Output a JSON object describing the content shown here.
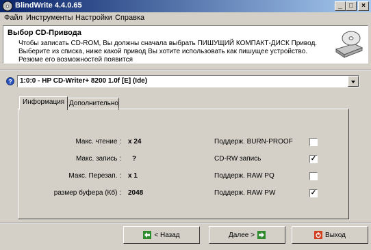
{
  "window": {
    "title": "BlindWrite 4.4.0.65"
  },
  "menu": [
    "Файл",
    "Инструменты",
    "Настройки",
    "Справка"
  ],
  "header": {
    "title": "Выбор CD-Привода",
    "lines": [
      "Чтобы записать CD-ROM, Вы должны сначала выбрать ПИШУЩИЙ КОМПАКТ-ДИСК Привод.",
      "Выберите из списка, ниже какой привод Вы хотите использовать как пишущее устройство.",
      "Резюме его возможностей появится"
    ]
  },
  "drive": {
    "selected": "1:0:0 - HP CD-Writer+ 8200 1.0f [E] (Ide)"
  },
  "tabs": [
    "Информация",
    "Дополнительно"
  ],
  "info": {
    "left": [
      {
        "label": "Макс. чтение :",
        "value": "x 24"
      },
      {
        "label": "Макс. запись :",
        "value": "?"
      },
      {
        "label": "Макс. Перезап. :",
        "value": "x 1"
      },
      {
        "label": "размер буфера (Кб) :",
        "value": "2048"
      }
    ],
    "right": [
      {
        "label": "Поддерж. BURN-PROOF",
        "checked": false
      },
      {
        "label": "CD-RW запись",
        "checked": true
      },
      {
        "label": "Поддерж. RAW PQ",
        "checked": false
      },
      {
        "label": "Поддерж. RAW PW",
        "checked": true
      }
    ]
  },
  "buttons": {
    "back": "< Назад",
    "next": "Далее >",
    "exit": "Выход"
  },
  "colors": {
    "title_start": "#0a246a",
    "title_end": "#a6caf0",
    "face": "#d4d0c8"
  }
}
